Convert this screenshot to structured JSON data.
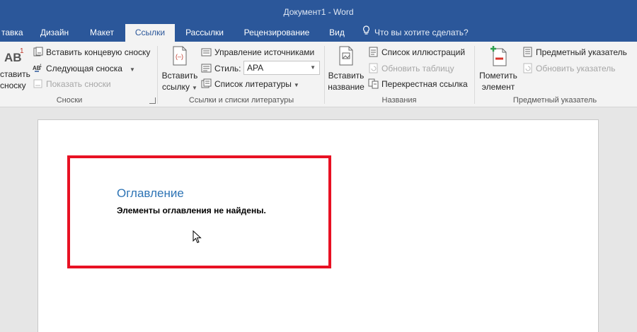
{
  "window": {
    "title": "Документ1 - Word"
  },
  "tabs": [
    {
      "label": "тавка",
      "active": false
    },
    {
      "label": "Дизайн",
      "active": false
    },
    {
      "label": "Макет",
      "active": false
    },
    {
      "label": "Ссылки",
      "active": true
    },
    {
      "label": "Рассылки",
      "active": false
    },
    {
      "label": "Рецензирование",
      "active": false
    },
    {
      "label": "Вид",
      "active": false
    }
  ],
  "tell_me": {
    "placeholder": "Что вы хотите сделать?",
    "icon": "lightbulb-icon"
  },
  "ribbon": {
    "footnotes": {
      "label": "Сноски",
      "insert_footnote_line1": "ставить",
      "insert_footnote_line2": "сноску",
      "insert_endnote": "Вставить концевую сноску",
      "next_footnote": "Следующая сноска",
      "show_notes": "Показать сноски"
    },
    "citations": {
      "label": "Ссылки и списки литературы",
      "insert_citation_line1": "Вставить",
      "insert_citation_line2": "ссылку",
      "manage_sources": "Управление источниками",
      "style_label": "Стиль:",
      "style_value": "APA",
      "bibliography": "Список литературы"
    },
    "captions": {
      "label": "Названия",
      "insert_caption_line1": "Вставить",
      "insert_caption_line2": "название",
      "table_of_figures": "Список иллюстраций",
      "update_table": "Обновить таблицу",
      "cross_reference": "Перекрестная ссылка"
    },
    "index": {
      "label": "Предметный указатель",
      "mark_entry_line1": "Пометить",
      "mark_entry_line2": "элемент",
      "insert_index": "Предметный указатель",
      "update_index": "Обновить указатель"
    }
  },
  "document": {
    "toc_title": "Оглавление",
    "toc_message": "Элементы оглавления не найдены."
  },
  "colors": {
    "accent": "#2b579a",
    "highlight": "#e81123",
    "heading": "#2e74b5"
  }
}
